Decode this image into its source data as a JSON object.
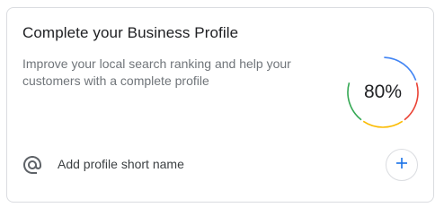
{
  "card": {
    "title": "Complete your Business Profile",
    "description": "Improve your local search ranking and help your customers with a complete profile",
    "progress": {
      "label": "80%",
      "fraction": 0.8,
      "colors": [
        "#4285f4",
        "#ea4335",
        "#fbbc04",
        "#34a853"
      ]
    },
    "task": {
      "icon": "at-sign-icon",
      "label": "Add profile short name",
      "action_icon": "plus-icon",
      "action_color": "#1a73e8"
    }
  }
}
